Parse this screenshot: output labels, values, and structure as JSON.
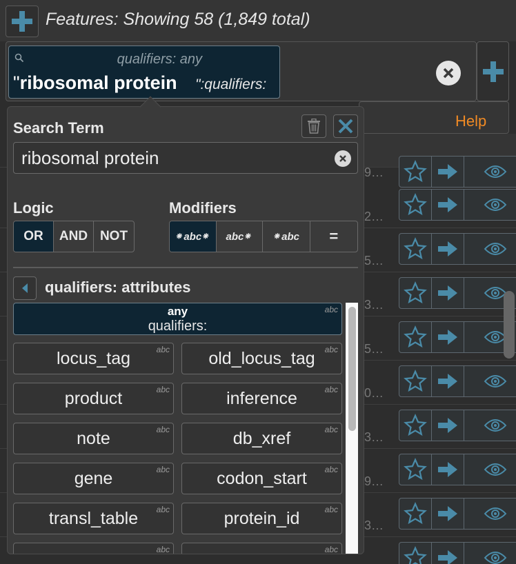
{
  "header": {
    "add_label": "+",
    "title": "Features: Showing 58 (1,849 total)"
  },
  "search_chip": {
    "scope": "qualifiers: any",
    "quote_open": "\"",
    "term": "ribosomal protein",
    "suffix": "\":qualifiers:"
  },
  "help_label": "Help",
  "row_truncations": [
    "9…",
    "2…",
    "5…",
    "3…",
    "5…",
    "0…",
    "3…",
    "9…",
    "3…"
  ],
  "popover": {
    "search_term_title": "Search Term",
    "search_term_value": "ribosomal protein",
    "logic_title": "Logic",
    "logic_options": [
      "OR",
      "AND",
      "NOT"
    ],
    "logic_selected": "OR",
    "modifiers_title": "Modifiers",
    "modifier_options": [
      "⁕abc⁕",
      "abc⁕",
      "⁕abc",
      "="
    ],
    "modifier_selected": "⁕abc⁕",
    "attributes_title": "qualifiers: attributes",
    "any_item": {
      "line1": "any",
      "line2": "qualifiers:",
      "type": "abc"
    },
    "items": [
      {
        "label": "locus_tag",
        "type": "abc"
      },
      {
        "label": "old_locus_tag",
        "type": "abc"
      },
      {
        "label": "product",
        "type": "abc"
      },
      {
        "label": "inference",
        "type": "abc"
      },
      {
        "label": "note",
        "type": "abc"
      },
      {
        "label": "db_xref",
        "type": "abc"
      },
      {
        "label": "gene",
        "type": "abc"
      },
      {
        "label": "codon_start",
        "type": "abc"
      },
      {
        "label": "transl_table",
        "type": "abc"
      },
      {
        "label": "protein_id",
        "type": "abc"
      },
      {
        "label": "",
        "type": "abc"
      },
      {
        "label": "",
        "type": "abc"
      }
    ]
  },
  "colors": {
    "accent_teal": "#4a8ba8",
    "selected_bg": "#0e2533",
    "help_orange": "#f08a24"
  }
}
